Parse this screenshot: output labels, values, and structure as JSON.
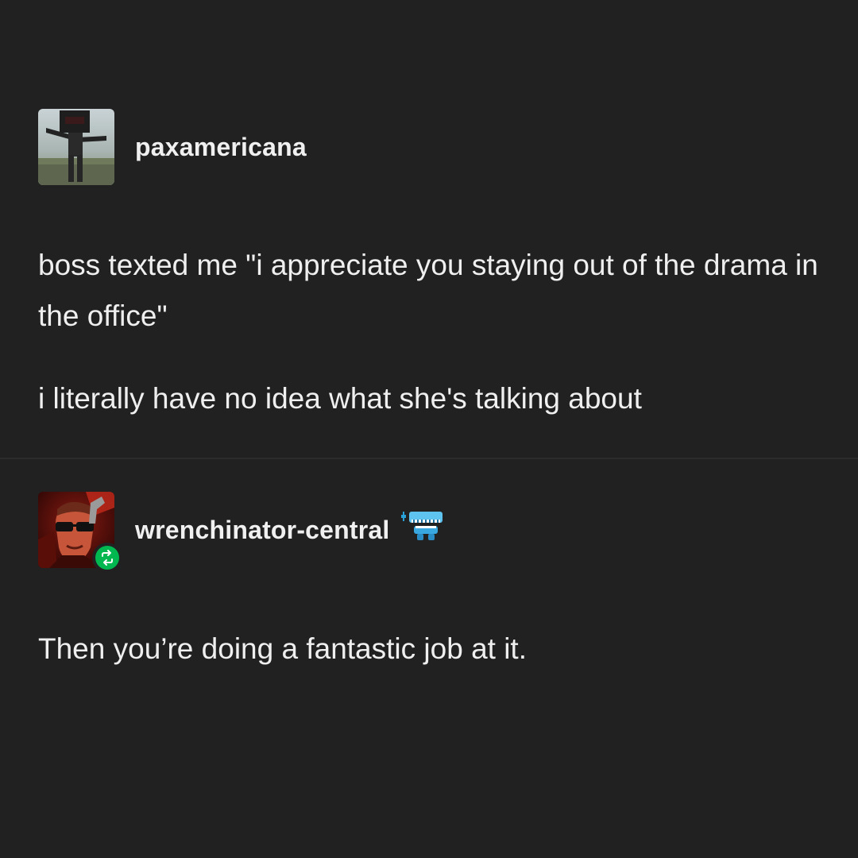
{
  "posts": [
    {
      "username": "paxamericana",
      "avatar_icon": "robot-figure-avatar",
      "paragraphs": [
        "boss texted me \"i appreciate you staying out of the drama in the office\"",
        "i literally have no idea what she's talking about"
      ]
    },
    {
      "username": "wrenchinator-central",
      "avatar_icon": "sunglasses-man-avatar",
      "badge_icon": "wind-up-teeth-icon",
      "reblog_icon": "reblog-icon",
      "paragraphs": [
        "Then you’re doing a fantastic job at it."
      ]
    }
  ],
  "colors": {
    "background": "#212121",
    "text": "#efefef",
    "reblog_green": "#00b84f"
  }
}
